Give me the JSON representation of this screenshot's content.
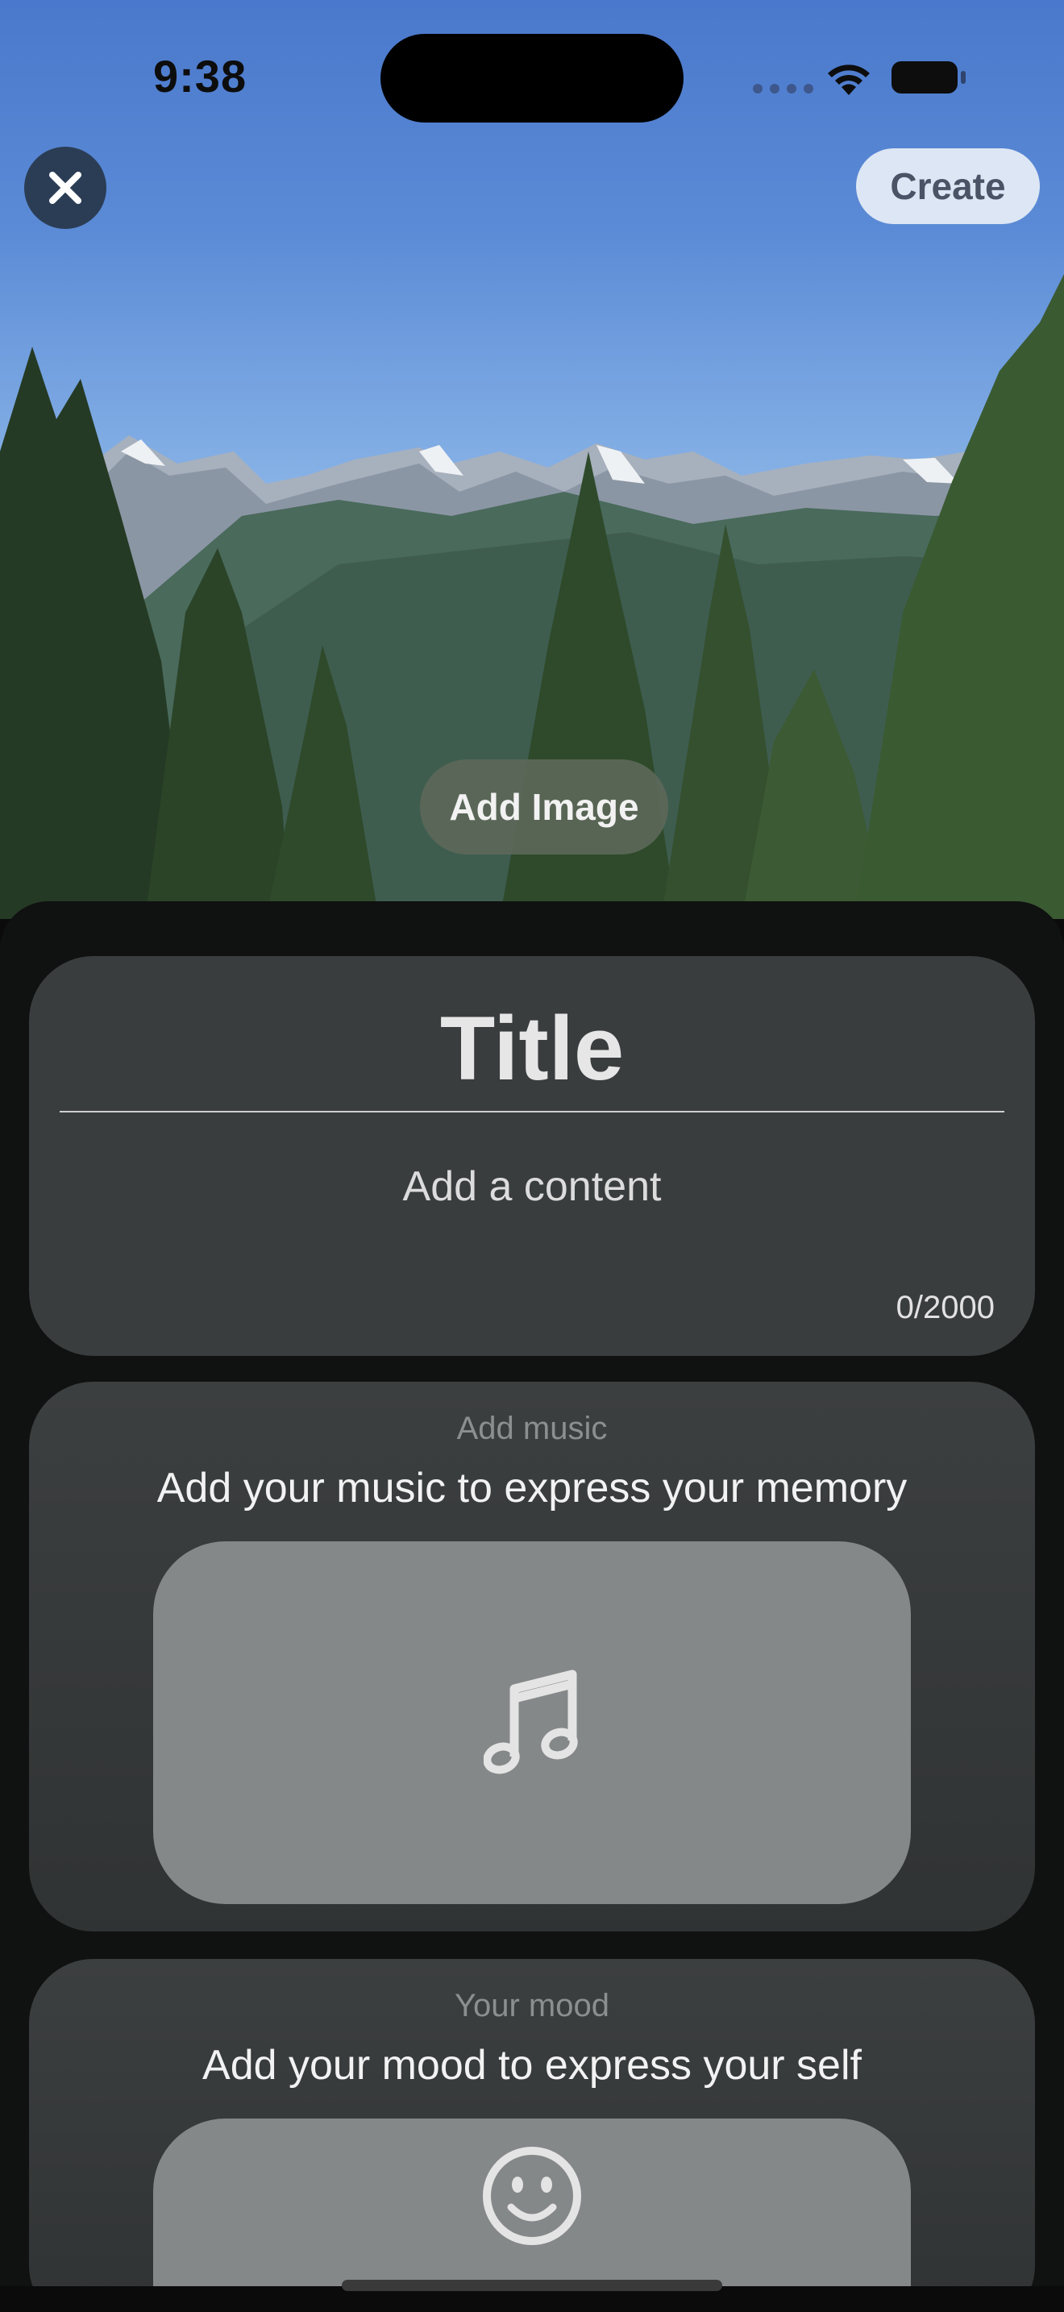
{
  "status_bar": {
    "time": "9:38"
  },
  "toolbar": {
    "create_label": "Create"
  },
  "hero": {
    "add_image_label": "Add Image"
  },
  "note": {
    "title_placeholder": "Title",
    "content_placeholder": "Add a content",
    "char_counter": "0/2000"
  },
  "music": {
    "label": "Add music",
    "description": "Add your music to express your memory"
  },
  "mood": {
    "label": "Your mood",
    "description": "Add your mood to express your self"
  },
  "colors": {
    "sheet": "#101111",
    "card": "#3a3d3e",
    "picker": "#858889",
    "create_button": "#dde6f4"
  }
}
